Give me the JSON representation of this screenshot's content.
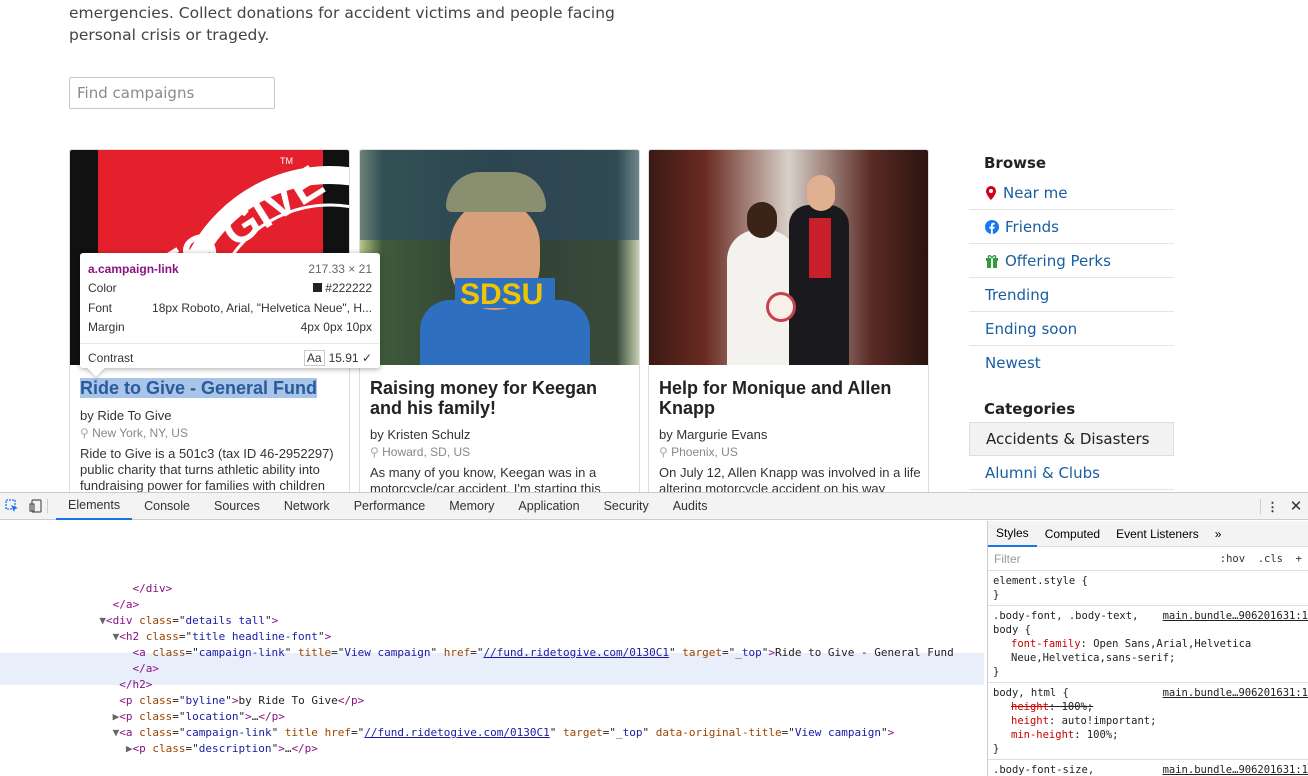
{
  "page": {
    "intro": "emergencies. Collect donations for accident victims and people facing personal crisis or tragedy.",
    "search_placeholder": "Find campaigns",
    "cards": [
      {
        "title": "Ride to Give - General Fund",
        "byline": "by Ride To Give",
        "location": "New York, NY, US",
        "description": "Ride to Give is a 501c3 (tax ID 46-2952297) public charity that turns athletic ability into fundraising power for families with children",
        "image_text": "TO GIVE",
        "image_tm": "TM"
      },
      {
        "title": "Raising money for Keegan and his family!",
        "byline": "by Kristen Schulz",
        "location": "Howard, SD, US",
        "description": "As many of you know, Keegan was in a motorcycle/car accident. I'm starting this",
        "image_text": "SDSU"
      },
      {
        "title": "Help for Monique and Allen Knapp",
        "byline": "by Margurie Evans",
        "location": "Phoenix, US",
        "description": "On July 12, Allen Knapp was involved in a life altering motorcycle accident on his way"
      }
    ],
    "sidebar": {
      "browse_title": "Browse",
      "browse": [
        {
          "label": "Near me",
          "icon": "map-pin-icon",
          "color": "#d0021b"
        },
        {
          "label": "Friends",
          "icon": "facebook-icon",
          "color": "#1877f2"
        },
        {
          "label": "Offering Perks",
          "icon": "gift-icon",
          "color": "#2e9e3e"
        },
        {
          "label": "Trending"
        },
        {
          "label": "Ending soon"
        },
        {
          "label": "Newest"
        }
      ],
      "categories_title": "Categories",
      "categories": [
        {
          "label": "Accidents & Disasters"
        },
        {
          "label": "Alumni & Clubs"
        }
      ]
    }
  },
  "tooltip": {
    "selector": "a.campaign-link",
    "size": "217.33 × 21",
    "color_label": "Color",
    "color_value": "#222222",
    "font_label": "Font",
    "font_value": "18px Roboto, Arial, \"Helvetica Neue\", H...",
    "margin_label": "Margin",
    "margin_value": "4px 0px 10px",
    "contrast_label": "Contrast",
    "contrast_aa": "Aa",
    "contrast_value": "15.91 ✓"
  },
  "devtools": {
    "tabs": [
      "Elements",
      "Console",
      "Sources",
      "Network",
      "Performance",
      "Memory",
      "Application",
      "Security",
      "Audits"
    ],
    "selected_tab": "Elements",
    "styles_tabs": [
      "Styles",
      "Computed",
      "Event Listeners",
      "»"
    ],
    "filter_placeholder": "Filter",
    "hov": ":hov",
    "cls": ".cls",
    "plus": "+",
    "element_style": "element.style {",
    "close_brace": "}",
    "rules": [
      {
        "selector": ".body-font, .body-text, body {",
        "source": "main.bundle…906201631:1",
        "props": [
          {
            "name": "font-family",
            "value": "Open Sans,Arial,Helvetica Neue,Helvetica,sans-serif;"
          }
        ]
      },
      {
        "selector": "body, html {",
        "source": "main.bundle…906201631:1",
        "props": [
          {
            "name": "height",
            "value": "100%;",
            "struck": true
          },
          {
            "name": "height",
            "value": "auto!important;"
          },
          {
            "name": "min-height",
            "value": "100%;"
          }
        ]
      },
      {
        "selector": ".body-font-size,",
        "source": "main.bundle…906201631:1",
        "props": []
      }
    ],
    "dom_lines": [
      {
        "indent": "                    ",
        "parts": [
          {
            "t": "tag",
            "v": "</div>"
          }
        ]
      },
      {
        "indent": "                 ",
        "parts": [
          {
            "t": "tag",
            "v": "</a>"
          }
        ]
      },
      {
        "indent": "               ▼",
        "parts": [
          {
            "t": "tag",
            "v": "<div "
          },
          {
            "t": "an",
            "v": "class"
          },
          {
            "t": "p",
            "v": "=\""
          },
          {
            "t": "av",
            "v": "details tall"
          },
          {
            "t": "p",
            "v": "\""
          },
          {
            "t": "tag",
            "v": ">"
          }
        ]
      },
      {
        "indent": "                 ▼",
        "parts": [
          {
            "t": "tag",
            "v": "<h2 "
          },
          {
            "t": "an",
            "v": "class"
          },
          {
            "t": "p",
            "v": "=\""
          },
          {
            "t": "av",
            "v": "title headline-font"
          },
          {
            "t": "p",
            "v": "\""
          },
          {
            "t": "tag",
            "v": ">"
          }
        ]
      },
      {
        "indent": "                    ",
        "parts": [
          {
            "t": "tag",
            "v": "<a "
          },
          {
            "t": "an",
            "v": "class"
          },
          {
            "t": "p",
            "v": "=\""
          },
          {
            "t": "av",
            "v": "campaign-link"
          },
          {
            "t": "p",
            "v": "\" "
          },
          {
            "t": "an",
            "v": "title"
          },
          {
            "t": "p",
            "v": "=\""
          },
          {
            "t": "av",
            "v": "View campaign"
          },
          {
            "t": "p",
            "v": "\" "
          },
          {
            "t": "an",
            "v": "href"
          },
          {
            "t": "p",
            "v": "=\""
          },
          {
            "t": "lnk",
            "v": "//fund.ridetogive.com/0130C1"
          },
          {
            "t": "p",
            "v": "\" "
          },
          {
            "t": "an",
            "v": "target"
          },
          {
            "t": "p",
            "v": "=\""
          },
          {
            "t": "av",
            "v": "_top"
          },
          {
            "t": "p",
            "v": "\""
          },
          {
            "t": "tag",
            "v": ">"
          },
          {
            "t": "p",
            "v": "Ride to Give - General Fund"
          }
        ]
      },
      {
        "indent": "                    ",
        "parts": [
          {
            "t": "tag",
            "v": "</a>"
          }
        ]
      },
      {
        "indent": "                  ",
        "parts": [
          {
            "t": "tag",
            "v": "</h2>"
          }
        ]
      },
      {
        "indent": "                  ",
        "parts": [
          {
            "t": "tag",
            "v": "<p "
          },
          {
            "t": "an",
            "v": "class"
          },
          {
            "t": "p",
            "v": "=\""
          },
          {
            "t": "av",
            "v": "byline"
          },
          {
            "t": "p",
            "v": "\""
          },
          {
            "t": "tag",
            "v": ">"
          },
          {
            "t": "p",
            "v": "by Ride To Give"
          },
          {
            "t": "tag",
            "v": "</p>"
          }
        ]
      },
      {
        "indent": "                 ▶",
        "parts": [
          {
            "t": "tag",
            "v": "<p "
          },
          {
            "t": "an",
            "v": "class"
          },
          {
            "t": "p",
            "v": "=\""
          },
          {
            "t": "av",
            "v": "location"
          },
          {
            "t": "p",
            "v": "\""
          },
          {
            "t": "tag",
            "v": ">"
          },
          {
            "t": "p",
            "v": "…"
          },
          {
            "t": "tag",
            "v": "</p>"
          }
        ]
      },
      {
        "indent": "                 ▼",
        "parts": [
          {
            "t": "tag",
            "v": "<a "
          },
          {
            "t": "an",
            "v": "class"
          },
          {
            "t": "p",
            "v": "=\""
          },
          {
            "t": "av",
            "v": "campaign-link"
          },
          {
            "t": "p",
            "v": "\" "
          },
          {
            "t": "an",
            "v": "title "
          },
          {
            "t": "an",
            "v": "href"
          },
          {
            "t": "p",
            "v": "=\""
          },
          {
            "t": "lnk",
            "v": "//fund.ridetogive.com/0130C1"
          },
          {
            "t": "p",
            "v": "\" "
          },
          {
            "t": "an",
            "v": "target"
          },
          {
            "t": "p",
            "v": "=\""
          },
          {
            "t": "av",
            "v": "_top"
          },
          {
            "t": "p",
            "v": "\" "
          },
          {
            "t": "an",
            "v": "data-original-title"
          },
          {
            "t": "p",
            "v": "=\""
          },
          {
            "t": "av",
            "v": "View campaign"
          },
          {
            "t": "p",
            "v": "\""
          },
          {
            "t": "tag",
            "v": ">"
          }
        ]
      },
      {
        "indent": "                   ▶",
        "parts": [
          {
            "t": "tag",
            "v": "<p "
          },
          {
            "t": "an",
            "v": "class"
          },
          {
            "t": "p",
            "v": "=\""
          },
          {
            "t": "av",
            "v": "description"
          },
          {
            "t": "p",
            "v": "\""
          },
          {
            "t": "tag",
            "v": ">"
          },
          {
            "t": "p",
            "v": "…"
          },
          {
            "t": "tag",
            "v": "</p>"
          }
        ]
      }
    ]
  }
}
